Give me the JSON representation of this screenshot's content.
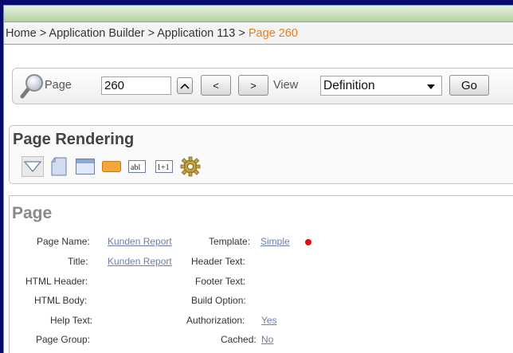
{
  "breadcrumb": {
    "home": "Home",
    "separator": ">",
    "app_builder": "Application Builder",
    "application": "Application 113",
    "current": "Page 260"
  },
  "toolbar": {
    "page_label": "Page",
    "page_value": "260",
    "up_label": "^",
    "prev_label": "<",
    "next_label": ">",
    "view_label": "View",
    "view_value": "Definition",
    "go_label": "Go"
  },
  "rendering": {
    "title": "Page Rendering",
    "icons": [
      "collapse-triangle-icon",
      "page-icon",
      "region-icon",
      "button-icon",
      "item-icon",
      "computation-icon",
      "process-gear-icon"
    ],
    "item_icon_text": "abl",
    "computation_icon_text": "1+1"
  },
  "page": {
    "title": "Page",
    "page_name_label": "Page Name:",
    "page_name_value": "Kunden Report",
    "title_label": "Title:",
    "title_value": "Kunden Report",
    "html_header_label": "HTML Header:",
    "html_body_label": "HTML Body:",
    "help_text_label": "Help Text:",
    "page_group_label": "Page Group:",
    "template_label": "Template:",
    "template_value": "Simple",
    "header_text_label": "Header Text:",
    "footer_text_label": "Footer Text:",
    "build_option_label": "Build Option:",
    "authorization_label": "Authorization:",
    "authorization_value": "Yes",
    "cached_label": "Cached:",
    "cached_value": "No"
  },
  "colors": {
    "accent_orange": "#f07a12",
    "link": "#6d7fa8",
    "background_blue": "#0a0a6e",
    "status_dot": "#e01010"
  }
}
